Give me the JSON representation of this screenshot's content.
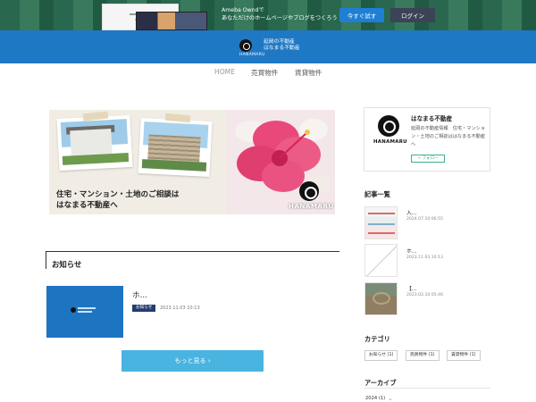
{
  "promo": {
    "text_line1": "Ameba Owndで",
    "text_line2": "あなただけのホームページやブログをつくろう",
    "try_label": "今すぐ試す",
    "login_label": "ログイン"
  },
  "header": {
    "site_title_line1": "延岡の不動産",
    "site_title_line2": "はなまる不動産",
    "logo_caption": "HANAMARU",
    "bg_color": "#1f78c4"
  },
  "nav": {
    "home": "HOME",
    "sale": "売買物件",
    "rent": "賃貸物件"
  },
  "hero": {
    "copy_line1": "住宅・マンション・土地のご相談は",
    "copy_line2": "はなまる不動産へ",
    "brand": "HANAMARU"
  },
  "news": {
    "heading": "お知らせ",
    "items": [
      {
        "title": "ホ...",
        "tag": "お知らせ",
        "date": "2023.11.03 10:13"
      }
    ],
    "more_label": "もっと見る ›",
    "button_color": "#49b4e0"
  },
  "profile": {
    "brand": "HANAMARU",
    "name": "はなまる不動産",
    "description": "延岡の不動産情報　住宅・マンション・土地のご相談ははなまる不動産へ",
    "follow_label": "+ フォロー"
  },
  "articles": {
    "heading": "記事一覧",
    "items": [
      {
        "title": "入...",
        "date": "2024.07.10 06:55"
      },
      {
        "title": "ホ...",
        "date": "2023.11.03 10:13"
      },
      {
        "title": "【...",
        "date": "2023.02.10 05:46"
      }
    ]
  },
  "categories": {
    "heading": "カテゴリ",
    "items": [
      {
        "label": "お知らせ  (1)"
      },
      {
        "label": "売買物件  (1)"
      },
      {
        "label": "賃貸物件  (1)"
      }
    ]
  },
  "archive": {
    "heading": "アーカイブ",
    "item": "2024 (1)",
    "chevron_icon": "chevron-down-icon"
  }
}
